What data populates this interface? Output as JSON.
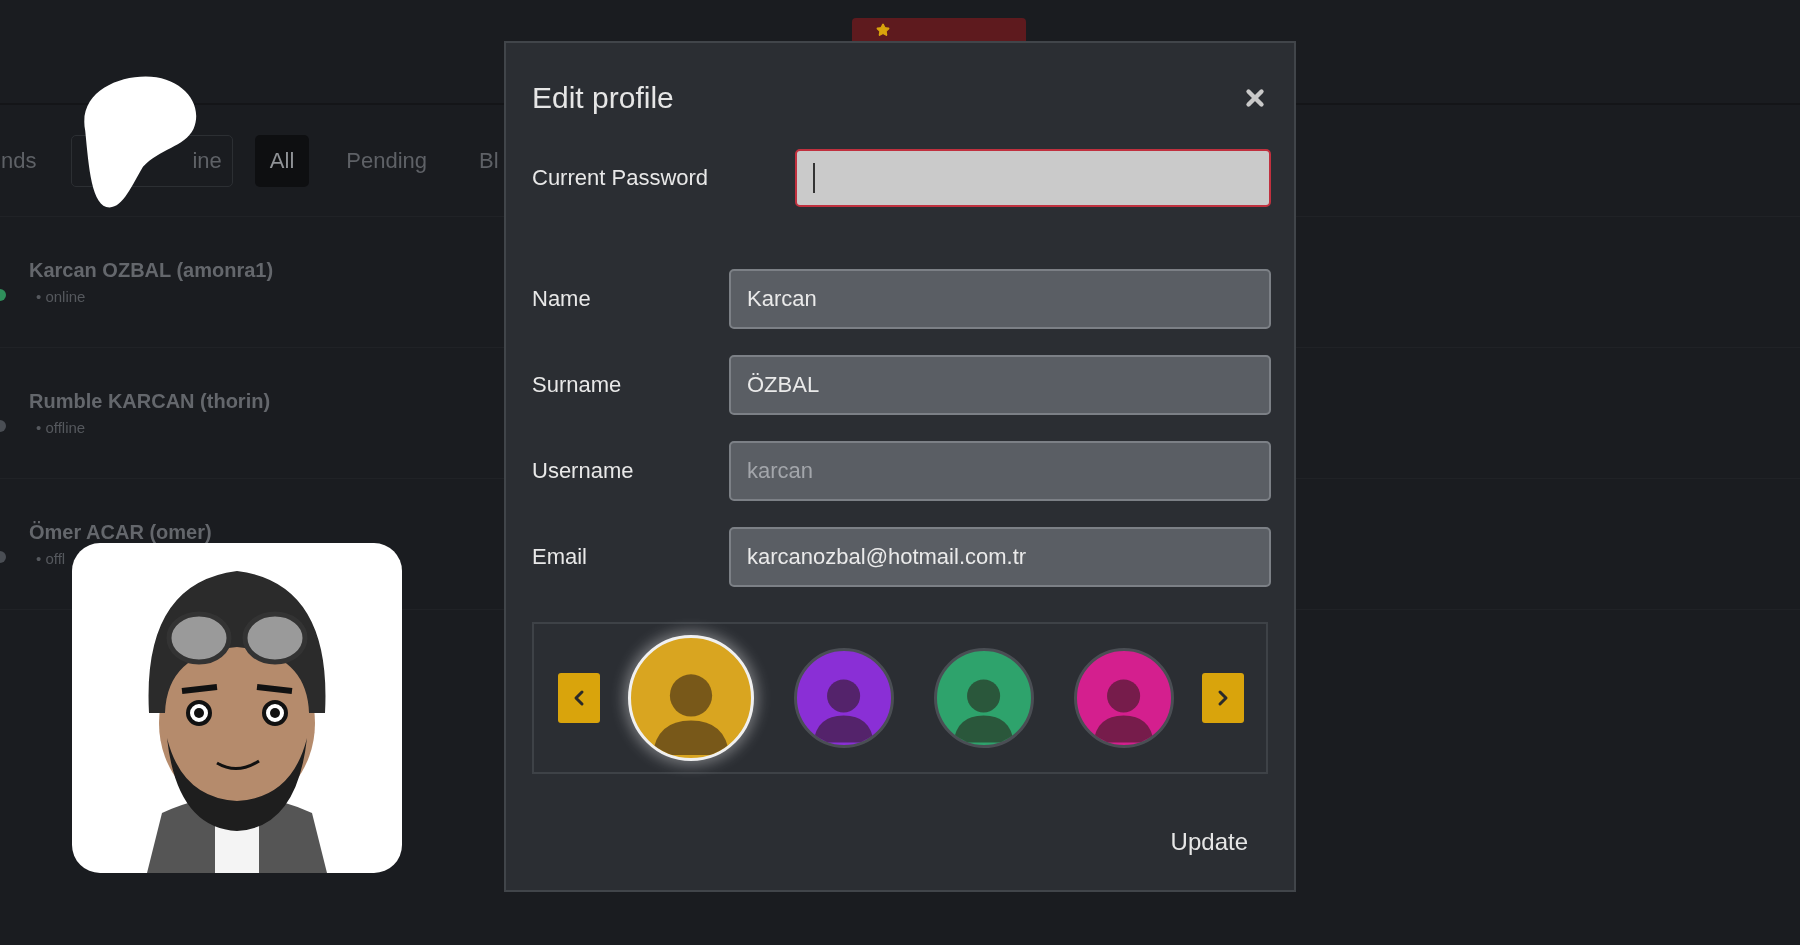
{
  "tabs": [
    {
      "label": "nds",
      "selected": false,
      "kind": "plain"
    },
    {
      "label": "ine",
      "selected": false,
      "kind": "outlined"
    },
    {
      "label": "All",
      "selected": true,
      "kind": "plain"
    },
    {
      "label": "Pending",
      "selected": false,
      "kind": "plain"
    },
    {
      "label": "Bl",
      "selected": false,
      "kind": "plain"
    }
  ],
  "friends": [
    {
      "name": "Karcan OZBAL (amonra1)",
      "status": "• online",
      "color": "#2f8f5b"
    },
    {
      "name": "Rumble KARCAN (thorin)",
      "status": "• offline",
      "color": "#4a4e54"
    },
    {
      "name": "Ömer ACAR (omer)",
      "status": "• offl",
      "color": "#4a4e54"
    }
  ],
  "modal": {
    "title": "Edit profile",
    "current_password": {
      "label": "Current Password",
      "focused": true,
      "invalid": true
    },
    "fields": [
      {
        "label": "Name",
        "value": "Karcan"
      },
      {
        "label": "Surname",
        "value": "ÖZBAL"
      },
      {
        "label": "Username",
        "placeholder": "karcan"
      },
      {
        "label": "Email",
        "value": "karcanozbal@hotmail.com.tr"
      }
    ],
    "avatars": [
      {
        "color": "#d9a520",
        "selected": true
      },
      {
        "color": "#8a2fd6",
        "selected": false
      },
      {
        "color": "#2ea36c",
        "selected": false
      },
      {
        "color": "#d41f8e",
        "selected": false
      }
    ],
    "submit": "Update"
  }
}
